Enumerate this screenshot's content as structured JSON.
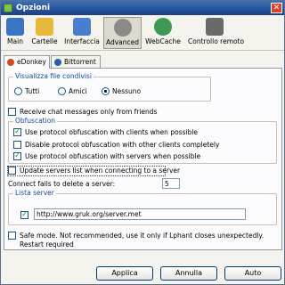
{
  "window": {
    "title": "Opzioni"
  },
  "toolbar": {
    "items": [
      {
        "label": "Main",
        "icon": "monitor-icon",
        "color": "#3a74c4",
        "active": false
      },
      {
        "label": "Cartelle",
        "icon": "folder-icon",
        "color": "#e8b83a",
        "active": false
      },
      {
        "label": "Interfaccia",
        "icon": "screen-icon",
        "color": "#4a7fd0",
        "active": false
      },
      {
        "label": "Advanced",
        "icon": "gears-icon",
        "color": "#8a8a8a",
        "active": true
      },
      {
        "label": "WebCache",
        "icon": "web-icon",
        "color": "#3c9a52",
        "active": false
      },
      {
        "label": "Controllo remoto",
        "icon": "remote-icon",
        "color": "#6a6a6a",
        "active": false
      }
    ]
  },
  "subtabs": [
    {
      "label": "eDonkey",
      "icon": "edonkey-icon",
      "color": "#d04a1e",
      "active": true
    },
    {
      "label": "Bittorrent",
      "icon": "bittorrent-icon",
      "color": "#2a5fa8",
      "active": false
    }
  ],
  "shared_files": {
    "title": "Visualizza file condivisi",
    "options": [
      {
        "label": "Tutti",
        "selected": false
      },
      {
        "label": "Amici",
        "selected": false
      },
      {
        "label": "Nessuno",
        "selected": true
      }
    ]
  },
  "receive_chat": {
    "label": "Receive chat messages only from friends",
    "checked": false
  },
  "obfuscation": {
    "title": "Obfuscation",
    "items": [
      {
        "label": "Use protocol obfuscation with clients when possible",
        "checked": true
      },
      {
        "label": "Disable protocol obfuscation with other clients completely",
        "checked": false
      },
      {
        "label": "Use protocol obfuscation with servers when possible",
        "checked": true
      }
    ]
  },
  "update_servers": {
    "label": "Update servers list when connecting to a server",
    "checked": false
  },
  "connect_fails": {
    "label": "Connect fails to delete a server:",
    "value": "5"
  },
  "server_list": {
    "title": "Lista server",
    "checked": true,
    "url": "http://www.gruk.org/server.met"
  },
  "safe_mode": {
    "label": "Safe mode. Not recommended, use it only if Lphant closes unexpectedly. Restart required",
    "checked": false
  },
  "buttons": {
    "apply": "Applica",
    "cancel": "Annulla",
    "auto": "Auto"
  }
}
